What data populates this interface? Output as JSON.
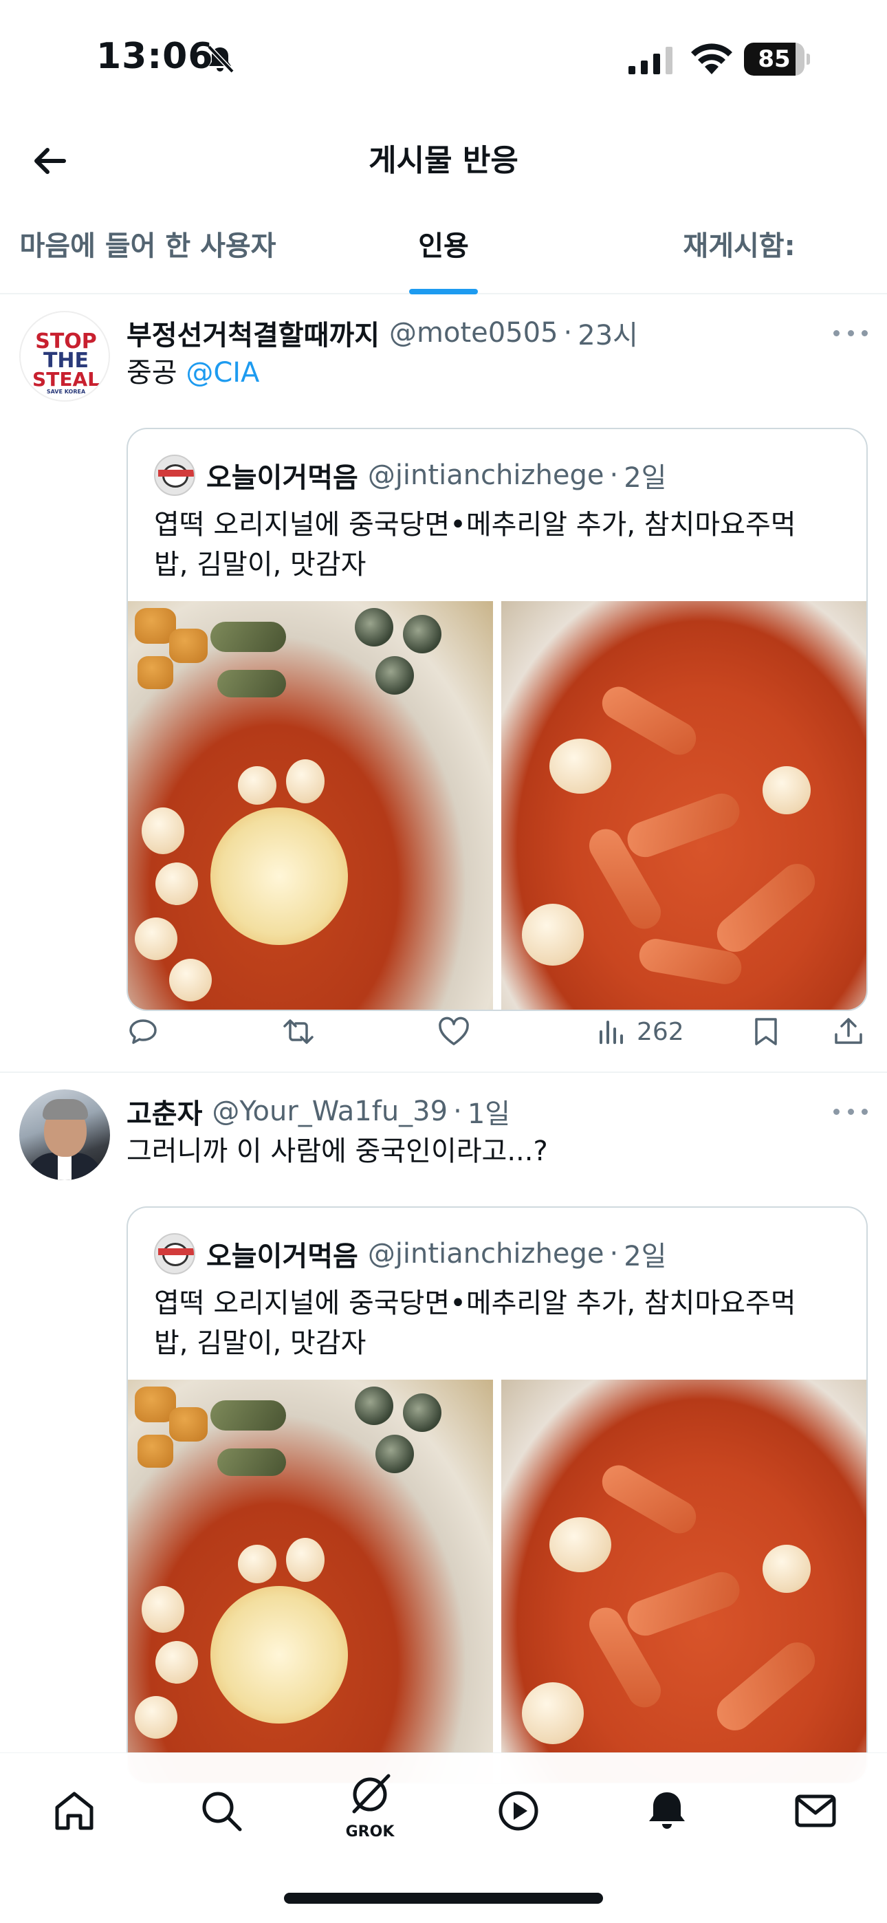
{
  "status_bar": {
    "time": "13:06",
    "battery_level": "85",
    "battery_fraction": 0.85
  },
  "header": {
    "title": "게시물 반응"
  },
  "tabs": [
    {
      "label": "마음에 들어 한 사용자",
      "active": false
    },
    {
      "label": "인용",
      "active": true
    },
    {
      "label": "재게시함:",
      "active": false
    }
  ],
  "posts": [
    {
      "display_name": "부정선거척결할때까지",
      "handle": "@mote0505",
      "separator": "·",
      "time": "23시",
      "text_prefix": "중공 ",
      "mention": "@CIA",
      "avatar_lines": [
        "STOP",
        "THE",
        "STEAL",
        "SAVE KOREA"
      ],
      "quote": {
        "display_name": "오늘이거먹음",
        "handle": "@jintianchizhege",
        "separator": "·",
        "time": "2일",
        "text": "엽떡 오리지널에 중국당면•메추리알 추가, 참치마요주먹밥, 김말이, 맛감자"
      },
      "views": "262"
    },
    {
      "display_name": "고춘자",
      "handle": "@Your_Wa1fu_39",
      "separator": "·",
      "time": "1일",
      "text": "그러니까 이 사람에 중국인이라고...?",
      "quote": {
        "display_name": "오늘이거먹음",
        "handle": "@jintianchizhege",
        "separator": "·",
        "time": "2일",
        "text": "엽떡 오리지널에 중국당면•메추리알 추가, 참치마요주먹밥, 김말이, 맛감자"
      }
    }
  ],
  "bottom_nav": {
    "grok_label": "GROK",
    "items": [
      "home-icon",
      "search-icon",
      "grok-icon",
      "video-icon",
      "notifications-icon",
      "messages-icon"
    ]
  },
  "colors": {
    "accent": "#1d9bf0",
    "text_primary": "#0f1419",
    "text_secondary": "#536471",
    "border": "#cfd9de"
  }
}
